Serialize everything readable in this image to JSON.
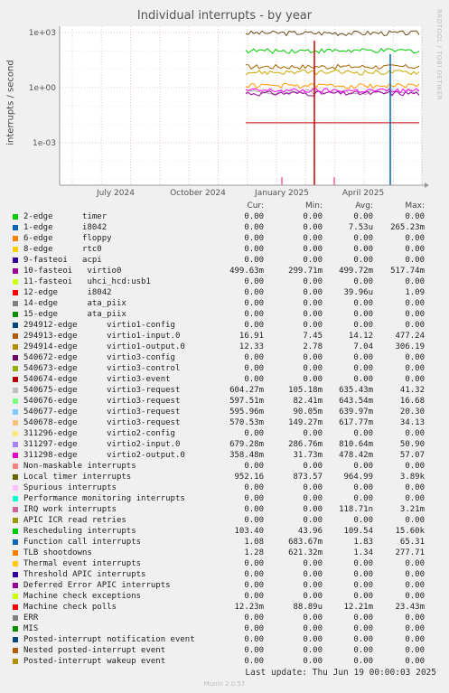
{
  "title": "Individual interrupts - by year",
  "ylabel": "interrupts / second",
  "watermark": "RRDTOOL / TOBI OETIKER",
  "legend_headers": {
    "cur": "Cur:",
    "min": "Min:",
    "avg": "Avg:",
    "max": "Max:"
  },
  "last_update": "Last update: Thu Jun 19 00:00:03 2025",
  "version": "Munin 2.0.57",
  "chart_data": {
    "type": "line",
    "yscale": "log",
    "y_ticks": [
      "1e-03",
      "1e+00",
      "1e+03"
    ],
    "x_ticks": [
      "July 2024",
      "October 2024",
      "January 2025",
      "April 2025"
    ],
    "grid": true,
    "series": [
      {
        "name": "Local timer interrupts",
        "color": "#6b4d1d",
        "level": 952
      },
      {
        "name": "Rescheduling interrupts",
        "color": "#00cc00",
        "level": 103
      },
      {
        "name": "294913-edge virtio1-input.0",
        "color": "#a86400",
        "level": 14
      },
      {
        "name": "540675-edge virtio3-request",
        "color": "#aaaaaa",
        "level": 0.6
      },
      {
        "name": "10-fasteoi virtio0",
        "color": "#990099",
        "level": 0.5
      },
      {
        "name": "311297-edge virtio2-input.0",
        "color": "#ff00ff",
        "level": 0.7
      },
      {
        "name": "294914-edge virtio1-output.0",
        "color": "#ccaa00",
        "level": 7
      },
      {
        "name": "TLB shootdowns",
        "color": "#ff9900",
        "level": 1.3
      },
      {
        "name": "Machine check polls",
        "color": "#cc0000",
        "level": 0.0122
      }
    ]
  },
  "legend": [
    {
      "color": "#00cc00",
      "name": "2-edge      timer",
      "cur": "0.00",
      "min": "0.00",
      "avg": "0.00",
      "max": "0.00"
    },
    {
      "color": "#0066b3",
      "name": "1-edge      i8042",
      "cur": "0.00",
      "min": "0.00",
      "avg": "7.53u",
      "max": "265.23m"
    },
    {
      "color": "#ff8000",
      "name": "6-edge      floppy",
      "cur": "0.00",
      "min": "0.00",
      "avg": "0.00",
      "max": "0.00"
    },
    {
      "color": "#ffcc00",
      "name": "8-edge      rtc0",
      "cur": "0.00",
      "min": "0.00",
      "avg": "0.00",
      "max": "0.00"
    },
    {
      "color": "#330099",
      "name": "9-fasteoi   acpi",
      "cur": "0.00",
      "min": "0.00",
      "avg": "0.00",
      "max": "0.00"
    },
    {
      "color": "#990099",
      "name": "10-fasteoi   virtio0",
      "cur": "499.63m",
      "min": "299.71m",
      "avg": "499.72m",
      "max": "517.74m"
    },
    {
      "color": "#ccff00",
      "name": "11-fasteoi   uhci_hcd:usb1",
      "cur": "0.00",
      "min": "0.00",
      "avg": "0.00",
      "max": "0.00"
    },
    {
      "color": "#ff0000",
      "name": "12-edge      i8042",
      "cur": "0.00",
      "min": "0.00",
      "avg": "39.96u",
      "max": "1.09"
    },
    {
      "color": "#808080",
      "name": "14-edge      ata_piix",
      "cur": "0.00",
      "min": "0.00",
      "avg": "0.00",
      "max": "0.00"
    },
    {
      "color": "#008f00",
      "name": "15-edge      ata_piix",
      "cur": "0.00",
      "min": "0.00",
      "avg": "0.00",
      "max": "0.00"
    },
    {
      "color": "#00487d",
      "name": "294912-edge      virtio1-config",
      "cur": "0.00",
      "min": "0.00",
      "avg": "0.00",
      "max": "0.00"
    },
    {
      "color": "#b35a00",
      "name": "294913-edge      virtio1-input.0",
      "cur": "16.91",
      "min": "7.45",
      "avg": "14.12",
      "max": "477.24"
    },
    {
      "color": "#b38f00",
      "name": "294914-edge      virtio1-output.0",
      "cur": "12.33",
      "min": "2.78",
      "avg": "7.04",
      "max": "306.19"
    },
    {
      "color": "#6b006b",
      "name": "540672-edge      virtio3-config",
      "cur": "0.00",
      "min": "0.00",
      "avg": "0.00",
      "max": "0.00"
    },
    {
      "color": "#8fb300",
      "name": "540673-edge      virtio3-control",
      "cur": "0.00",
      "min": "0.00",
      "avg": "0.00",
      "max": "0.00"
    },
    {
      "color": "#b30000",
      "name": "540674-edge      virtio3-event",
      "cur": "0.00",
      "min": "0.00",
      "avg": "0.00",
      "max": "0.00"
    },
    {
      "color": "#bebebe",
      "name": "540675-edge      virtio3-request",
      "cur": "604.27m",
      "min": "105.18m",
      "avg": "635.43m",
      "max": "41.32"
    },
    {
      "color": "#80ff80",
      "name": "540676-edge      virtio3-request",
      "cur": "597.51m",
      "min": "82.41m",
      "avg": "643.54m",
      "max": "16.68"
    },
    {
      "color": "#80c9ff",
      "name": "540677-edge      virtio3-request",
      "cur": "595.96m",
      "min": "90.05m",
      "avg": "639.97m",
      "max": "20.30"
    },
    {
      "color": "#ffc080",
      "name": "540678-edge      virtio3-request",
      "cur": "570.53m",
      "min": "149.27m",
      "avg": "617.77m",
      "max": "34.13"
    },
    {
      "color": "#ffe680",
      "name": "311296-edge      virtio2-config",
      "cur": "0.00",
      "min": "0.00",
      "avg": "0.00",
      "max": "0.00"
    },
    {
      "color": "#aa80ff",
      "name": "311297-edge      virtio2-input.0",
      "cur": "679.28m",
      "min": "286.76m",
      "avg": "810.64m",
      "max": "50.90"
    },
    {
      "color": "#ee00cc",
      "name": "311298-edge      virtio2-output.0",
      "cur": "358.48m",
      "min": "31.73m",
      "avg": "478.42m",
      "max": "57.07"
    },
    {
      "color": "#ff8080",
      "name": "Non-maskable interrupts",
      "cur": "0.00",
      "min": "0.00",
      "avg": "0.00",
      "max": "0.00"
    },
    {
      "color": "#666600",
      "name": "Local timer interrupts",
      "cur": "952.16",
      "min": "873.57",
      "avg": "964.99",
      "max": "3.89k"
    },
    {
      "color": "#ffbfff",
      "name": "Spurious interrupts",
      "cur": "0.00",
      "min": "0.00",
      "avg": "0.00",
      "max": "0.00"
    },
    {
      "color": "#00ffcc",
      "name": "Performance monitoring interrupts",
      "cur": "0.00",
      "min": "0.00",
      "avg": "0.00",
      "max": "0.00"
    },
    {
      "color": "#cc6699",
      "name": "IRQ work interrupts",
      "cur": "0.00",
      "min": "0.00",
      "avg": "118.71n",
      "max": "3.21m"
    },
    {
      "color": "#999900",
      "name": "APIC ICR read retries",
      "cur": "0.00",
      "min": "0.00",
      "avg": "0.00",
      "max": "0.00"
    },
    {
      "color": "#00cc00",
      "name": "Rescheduling interrupts",
      "cur": "103.40",
      "min": "43.96",
      "avg": "109.54",
      "max": "15.60k"
    },
    {
      "color": "#0066b3",
      "name": "Function call interrupts",
      "cur": "1.08",
      "min": "683.67m",
      "avg": "1.83",
      "max": "65.31"
    },
    {
      "color": "#ff8000",
      "name": "TLB shootdowns",
      "cur": "1.28",
      "min": "621.32m",
      "avg": "1.34",
      "max": "277.71"
    },
    {
      "color": "#ffcc00",
      "name": "Thermal event interrupts",
      "cur": "0.00",
      "min": "0.00",
      "avg": "0.00",
      "max": "0.00"
    },
    {
      "color": "#330099",
      "name": "Threshold APIC interrupts",
      "cur": "0.00",
      "min": "0.00",
      "avg": "0.00",
      "max": "0.00"
    },
    {
      "color": "#990099",
      "name": "Deferred Error APIC interrupts",
      "cur": "0.00",
      "min": "0.00",
      "avg": "0.00",
      "max": "0.00"
    },
    {
      "color": "#ccff00",
      "name": "Machine check exceptions",
      "cur": "0.00",
      "min": "0.00",
      "avg": "0.00",
      "max": "0.00"
    },
    {
      "color": "#ff0000",
      "name": "Machine check polls",
      "cur": "12.23m",
      "min": "88.89u",
      "avg": "12.21m",
      "max": "23.43m"
    },
    {
      "color": "#808080",
      "name": "ERR",
      "cur": "0.00",
      "min": "0.00",
      "avg": "0.00",
      "max": "0.00"
    },
    {
      "color": "#008f00",
      "name": "MIS",
      "cur": "0.00",
      "min": "0.00",
      "avg": "0.00",
      "max": "0.00"
    },
    {
      "color": "#00487d",
      "name": "Posted-interrupt notification event",
      "cur": "0.00",
      "min": "0.00",
      "avg": "0.00",
      "max": "0.00"
    },
    {
      "color": "#b35a00",
      "name": "Nested posted-interrupt event",
      "cur": "0.00",
      "min": "0.00",
      "avg": "0.00",
      "max": "0.00"
    },
    {
      "color": "#b38f00",
      "name": "Posted-interrupt wakeup event",
      "cur": "0.00",
      "min": "0.00",
      "avg": "0.00",
      "max": "0.00"
    }
  ]
}
